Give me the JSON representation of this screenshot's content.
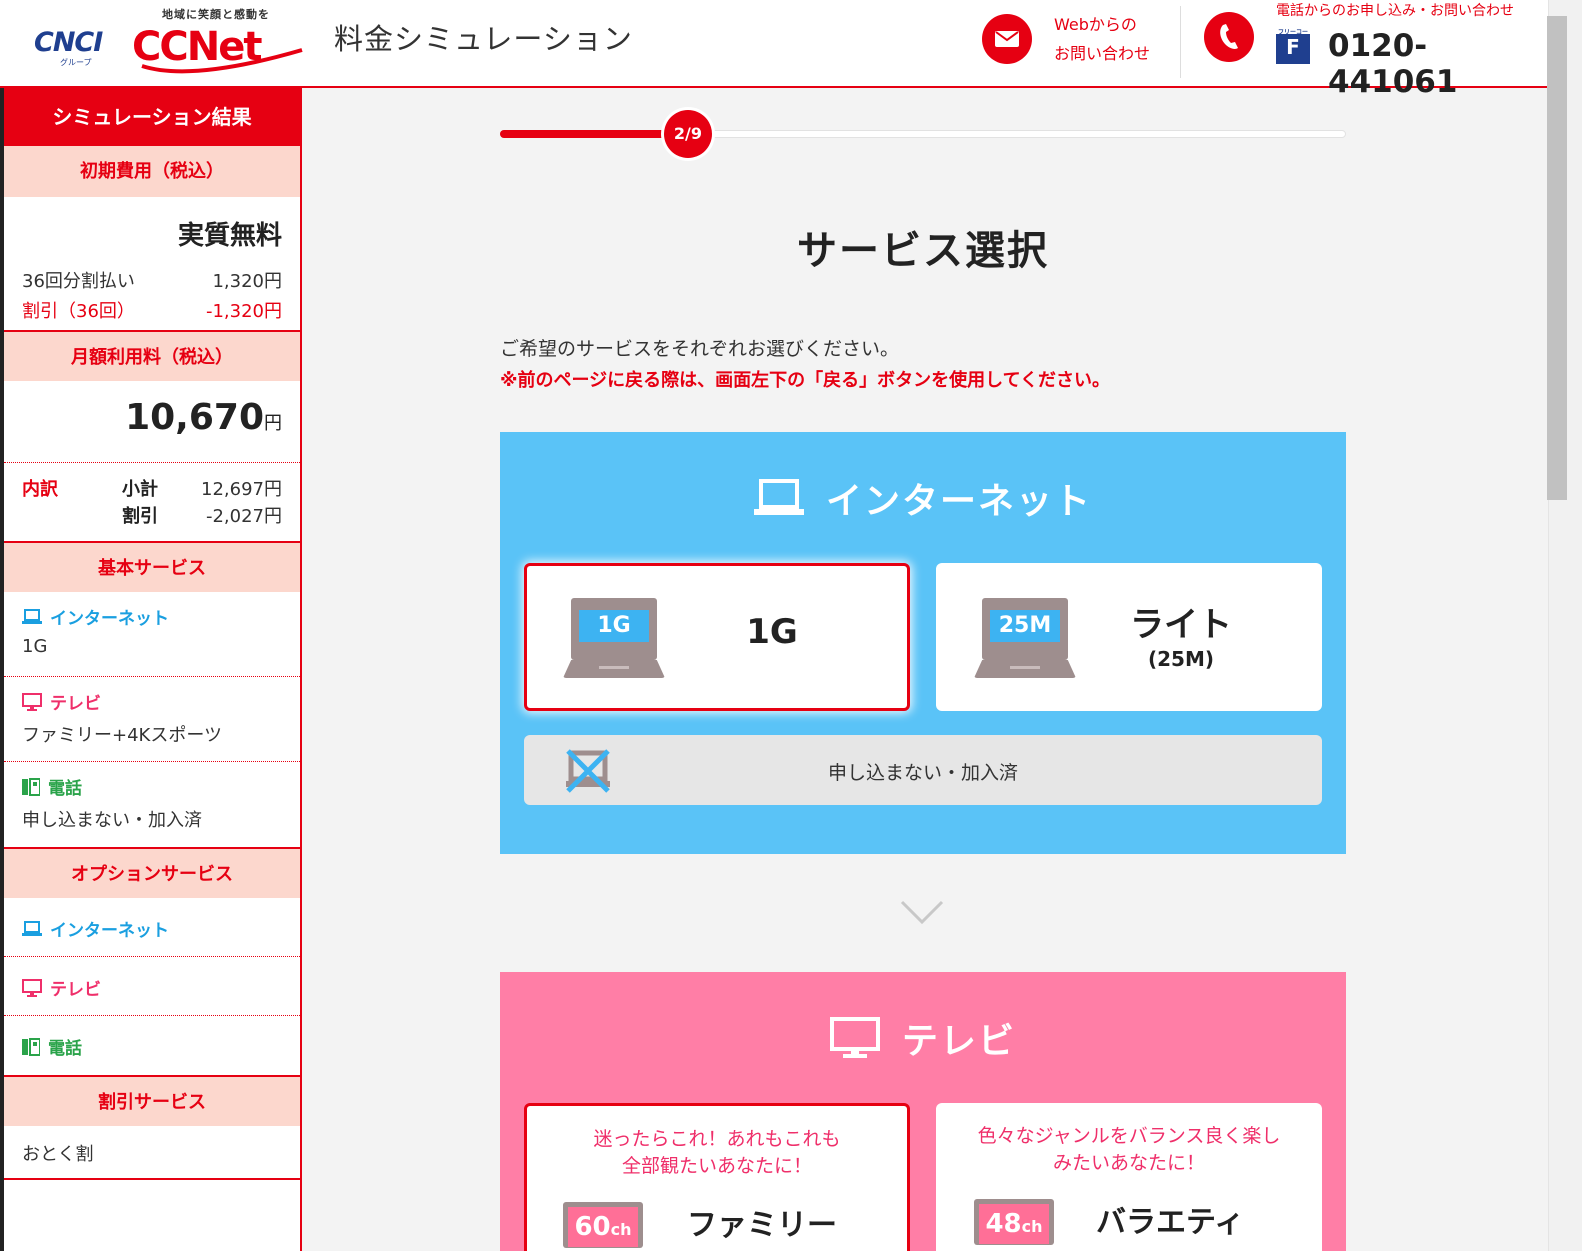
{
  "header": {
    "logo_cnci": "CNCI",
    "logo_cnci_sub": "グループ",
    "logo_ccnet_tag": "地域に笑顔と感動を",
    "logo_ccnet": "CCNet",
    "title": "料金シミュレーション",
    "web_contact_line1": "Webからの",
    "web_contact_line2": "お問い合わせ",
    "tel_note": "電話からのお申し込み・お問い合わせ",
    "freedial_mark": "F",
    "freedial_sub": "フリーコール",
    "tel_number": "0120-441061"
  },
  "sidebar": {
    "heading": "シミュレーション結果",
    "initial_cost": {
      "label": "初期費用（税込）",
      "headline": "実質無料",
      "installment_label": "36回分割払い",
      "installment_value": "1,320円",
      "discount_label": "割引（36回）",
      "discount_value": "-1,320円"
    },
    "monthly": {
      "label": "月額利用料（税込）",
      "amount": "10,670",
      "unit": "円",
      "breakdown_label": "内訳",
      "subtotal_label": "小計",
      "subtotal_value": "12,697円",
      "discount_label": "割引",
      "discount_value": "-2,027円"
    },
    "basic_services": {
      "label": "基本サービス",
      "items": [
        {
          "label": "インターネット",
          "value": "1G",
          "icon": "laptop-icon"
        },
        {
          "label": "テレビ",
          "value": "ファミリー+4Kスポーツ",
          "icon": "tv-icon"
        },
        {
          "label": "電話",
          "value": "申し込まない・加入済",
          "icon": "phone-icon"
        }
      ]
    },
    "option_services": {
      "label": "オプションサービス",
      "items": [
        {
          "label": "インターネット",
          "icon": "laptop-icon"
        },
        {
          "label": "テレビ",
          "icon": "tv-icon"
        },
        {
          "label": "電話",
          "icon": "phone-icon"
        }
      ]
    },
    "discount_services": {
      "label": "割引サービス",
      "value": "おとく割"
    }
  },
  "progress": {
    "label": "2/9",
    "fraction": 0.2222
  },
  "main": {
    "title": "サービス選択",
    "lead": "ご希望のサービスをそれぞれお選びください。",
    "warning": "※前のページに戻る際は、画面左下の「戻る」ボタンを使用してください。",
    "internet": {
      "title": "インターネット",
      "options": [
        {
          "badge": "1G",
          "name": "1G",
          "sub": "",
          "selected": true
        },
        {
          "badge": "25M",
          "name": "ライト",
          "sub": "(25M)",
          "selected": false
        }
      ],
      "decline_label": "申し込まない・加入済"
    },
    "tv": {
      "title": "テレビ",
      "options": [
        {
          "catch_line1": "迷ったらこれ！あれもこれも",
          "catch_line2": "全部観たいあなたに！",
          "channels": "60",
          "ch_unit": "ch",
          "name": "ファミリー",
          "selected": true
        },
        {
          "catch_line1": "色々なジャンルをバランス良く楽し",
          "catch_line2": "みたいあなたに！",
          "channels": "48",
          "ch_unit": "ch",
          "name": "バラエティ",
          "selected": false
        }
      ]
    }
  },
  "colors": {
    "brand_red": "#e60012",
    "internet_panel": "#5ac3f7",
    "tv_panel": "#ff7ea6",
    "section_bg": "#fcd7cd"
  }
}
